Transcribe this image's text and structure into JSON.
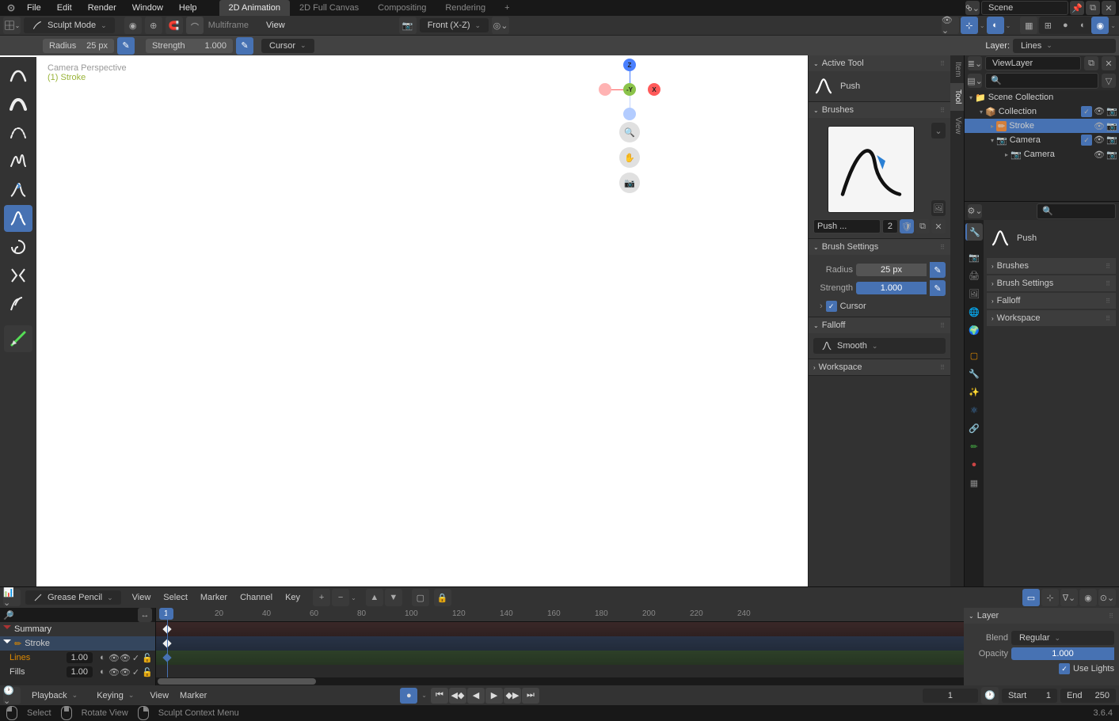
{
  "topbar": {
    "menus": [
      "File",
      "Edit",
      "Render",
      "Window",
      "Help"
    ],
    "tabs": [
      "2D Animation",
      "2D Full Canvas",
      "Compositing",
      "Rendering"
    ],
    "active_tab": 0,
    "scene_label": "Scene",
    "viewlayer_label": "ViewLayer"
  },
  "header1": {
    "mode": "Sculpt Mode",
    "multiframe": "Multiframe",
    "view": "View",
    "orientation": "Front (X-Z)"
  },
  "header2": {
    "radius_label": "Radius",
    "radius_val": "25 px",
    "strength_label": "Strength",
    "strength_val": "1.000",
    "cursor": "Cursor",
    "layer_label": "Layer:",
    "layer_val": "Lines"
  },
  "viewport": {
    "persp": "Camera Perspective",
    "obj": "(1) Stroke"
  },
  "tools": [
    "smooth",
    "thickness",
    "strength",
    "randomize",
    "grab",
    "push",
    "twist",
    "pinch",
    "clone"
  ],
  "active_tool": 5,
  "npanel": {
    "active_tool_hdr": "Active Tool",
    "tool_name": "Push",
    "brushes_hdr": "Brushes",
    "brush_name": "Push ...",
    "brush_users": "2",
    "settings_hdr": "Brush Settings",
    "radius_label": "Radius",
    "radius_val": "25 px",
    "strength_label": "Strength",
    "strength_val": "1.000",
    "cursor": "Cursor",
    "falloff_hdr": "Falloff",
    "falloff_val": "Smooth",
    "workspace_hdr": "Workspace"
  },
  "ntabs": [
    "Item",
    "Tool",
    "View"
  ],
  "outliner": {
    "root": "Scene Collection",
    "coll": "Collection",
    "items": [
      {
        "name": "Stroke",
        "sel": true
      },
      {
        "name": "Camera"
      },
      {
        "name": "Camera",
        "child": true
      }
    ]
  },
  "props": {
    "tool_name": "Push",
    "panels": [
      "Brushes",
      "Brush Settings",
      "Falloff",
      "Workspace"
    ]
  },
  "timeline": {
    "editor": "Grease Pencil",
    "menus": [
      "View",
      "Select",
      "Marker",
      "Channel",
      "Key"
    ],
    "summary": "Summary",
    "stroke": "Stroke",
    "lines": "Lines",
    "lines_val": "1.00",
    "fills": "Fills",
    "fills_val": "1.00",
    "ticks": [
      20,
      40,
      60,
      80,
      100,
      120,
      140,
      160,
      180,
      200,
      220,
      240
    ],
    "frame_current": "1",
    "layer_hdr": "Layer",
    "blend_label": "Blend",
    "blend_val": "Regular",
    "opacity_label": "Opacity",
    "opacity_val": "1.000",
    "uselights": "Use Lights",
    "foot_menus": [
      "Playback",
      "Keying",
      "View",
      "Marker"
    ],
    "start_label": "Start",
    "start_val": "1",
    "end_label": "End",
    "end_val": "250",
    "cur_val": "1"
  },
  "status": {
    "select": "Select",
    "rotate": "Rotate View",
    "context": "Sculpt Context Menu",
    "version": "3.6.4"
  }
}
